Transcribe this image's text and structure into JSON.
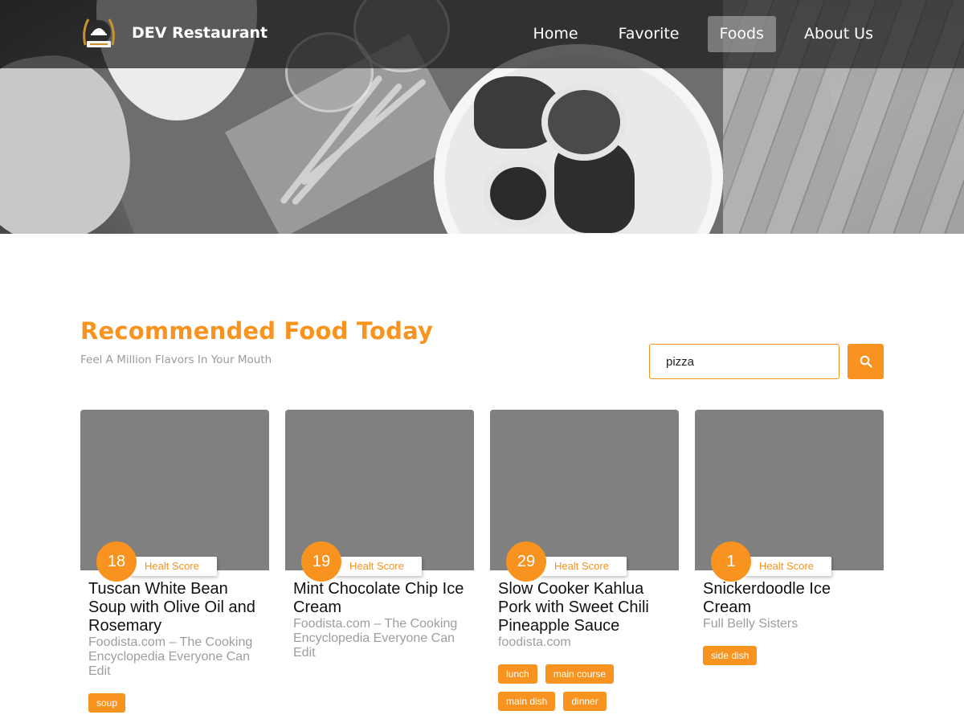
{
  "brand": {
    "name": "DEV Restaurant",
    "logo_icon": "restaurant-badge-icon"
  },
  "nav": {
    "items": [
      {
        "label": "Home",
        "active": false
      },
      {
        "label": "Favorite",
        "active": false
      },
      {
        "label": "Foods",
        "active": true
      },
      {
        "label": "About Us",
        "active": false
      }
    ]
  },
  "hero": {
    "image": "black-and-white-breakfast-table-photo"
  },
  "section": {
    "title": "Recommended Food Today",
    "subtitle": "Feel A Million Flavors In Your Mouth"
  },
  "search": {
    "value": "pizza",
    "button_icon": "search-icon"
  },
  "score_label": "Healt Score",
  "colors": {
    "accent": "#f7931e",
    "image_placeholder": "#808080",
    "nav_overlay": "#141414"
  },
  "cards": [
    {
      "score": "18",
      "title": "Tuscan White Bean Soup with Olive Oil and Rosemary",
      "source": "Foodista.com – The Cooking Encyclopedia Everyone Can Edit",
      "tags": [
        "soup"
      ]
    },
    {
      "score": "19",
      "title": "Mint Chocolate Chip Ice Cream",
      "source": "Foodista.com – The Cooking Encyclopedia Everyone Can Edit",
      "tags": []
    },
    {
      "score": "29",
      "title": "Slow Cooker Kahlua Pork with Sweet Chili Pineapple Sauce",
      "source": "foodista.com",
      "tags": [
        "lunch",
        "main course",
        "main dish",
        "dinner"
      ]
    },
    {
      "score": "1",
      "title": "Snickerdoodle Ice Cream",
      "source": "Full Belly Sisters",
      "tags": [
        "side dish"
      ]
    }
  ]
}
